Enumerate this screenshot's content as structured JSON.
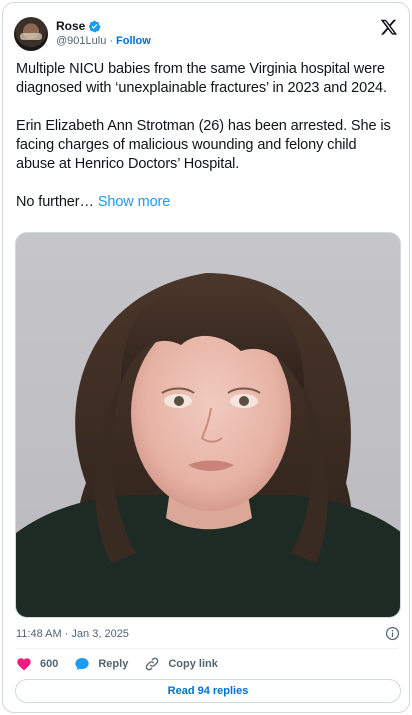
{
  "author": {
    "display_name": "Rose",
    "handle": "@901Lulu",
    "separator": "·",
    "follow_label": "Follow",
    "verified": true
  },
  "tweet": {
    "paragraph_1": "Multiple NICU babies from the same Virginia hospital were diagnosed with ‘unexplainable fractures’ in 2023 and 2024.",
    "paragraph_2": "Erin Elizabeth Ann Strotman (26) has been arrested. She is facing charges of malicious wounding and felony child abuse at Henrico Doctors’ Hospital.",
    "paragraph_3": "No further…",
    "show_more_label": "Show more",
    "timestamp": "11:48 AM · Jan 3, 2025"
  },
  "actions": {
    "like_count": "600",
    "reply_label": "Reply",
    "copy_link_label": "Copy link",
    "read_replies_label": "Read 94 replies"
  },
  "icons": {
    "brand": "x-logo-icon",
    "verified": "verified-badge-icon",
    "like": "heart-icon",
    "reply": "speech-bubble-icon",
    "copy": "link-icon",
    "info": "info-icon"
  },
  "colors": {
    "accent": "#1d9bf0",
    "link": "#006fd6",
    "like": "#f91880",
    "text": "#0f1419",
    "muted": "#536471"
  }
}
